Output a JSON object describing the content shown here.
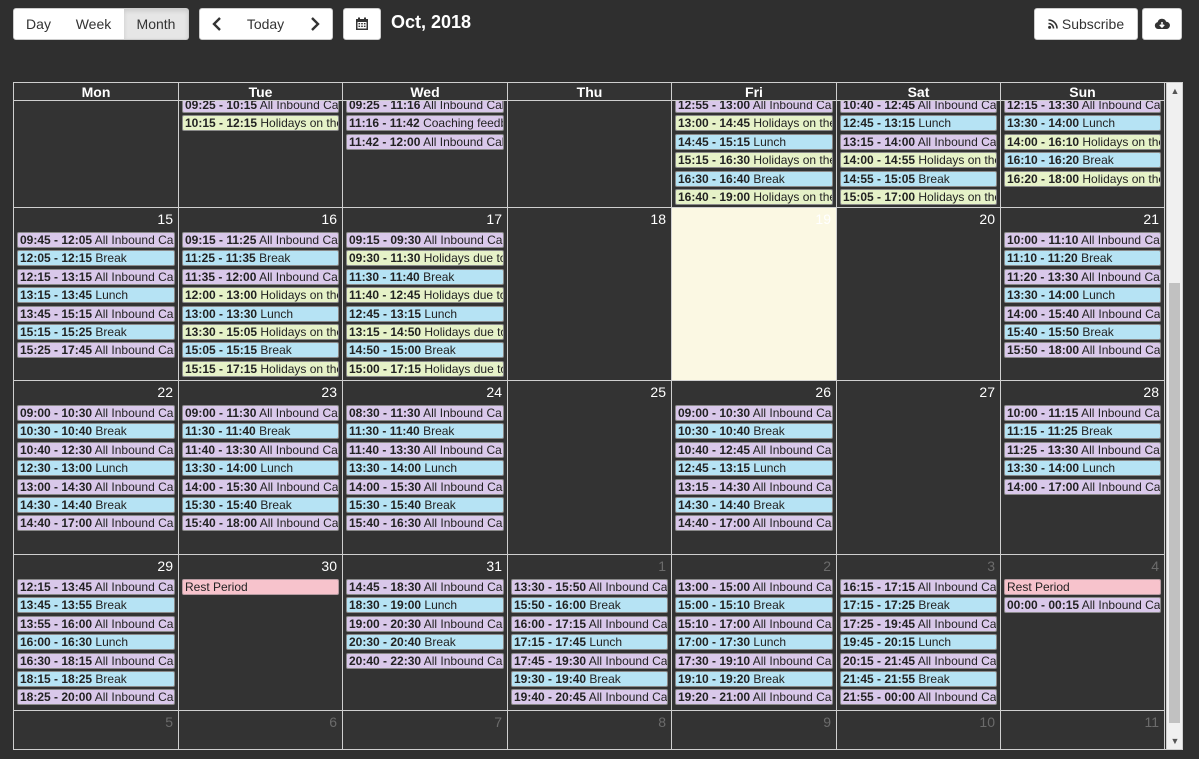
{
  "toolbar": {
    "day_label": "Day",
    "week_label": "Week",
    "month_label": "Month",
    "today_label": "Today",
    "title": "Oct, 2018",
    "subscribe_label": "Subscribe"
  },
  "weekdays": [
    "Mon",
    "Tue",
    "Wed",
    "Thu",
    "Fri",
    "Sat",
    "Sun"
  ],
  "weeks": [
    [
      {
        "day": "",
        "other": false,
        "events": []
      },
      {
        "day": "",
        "other": false,
        "events": [
          {
            "time": "09:25 - 10:15",
            "label": "All Inbound Ca",
            "kind": "inbound"
          },
          {
            "time": "10:15 - 12:15",
            "label": "Holidays on the",
            "kind": "holiday"
          }
        ]
      },
      {
        "day": "",
        "other": false,
        "events": [
          {
            "time": "09:25 - 11:16",
            "label": "All Inbound Cal",
            "kind": "inbound"
          },
          {
            "time": "11:16 - 11:42",
            "label": "Coaching feedb",
            "kind": "coaching"
          },
          {
            "time": "11:42 - 12:00",
            "label": "All Inbound Cal",
            "kind": "inbound"
          }
        ]
      },
      {
        "day": "",
        "other": false,
        "events": []
      },
      {
        "day": "",
        "other": false,
        "events": [
          {
            "time": "12:55 - 13:00",
            "label": "All Inbound Ca",
            "kind": "inbound"
          },
          {
            "time": "13:00 - 14:45",
            "label": "Holidays on the",
            "kind": "holiday"
          },
          {
            "time": "14:45 - 15:15",
            "label": "Lunch",
            "kind": "lunch"
          },
          {
            "time": "15:15 - 16:30",
            "label": "Holidays on the",
            "kind": "holiday"
          },
          {
            "time": "16:30 - 16:40",
            "label": "Break",
            "kind": "break"
          },
          {
            "time": "16:40 - 19:00",
            "label": "Holidays on the",
            "kind": "holiday"
          }
        ]
      },
      {
        "day": "",
        "other": false,
        "events": [
          {
            "time": "10:40 - 12:45",
            "label": "All Inbound Ca",
            "kind": "inbound"
          },
          {
            "time": "12:45 - 13:15",
            "label": "Lunch",
            "kind": "lunch"
          },
          {
            "time": "13:15 - 14:00",
            "label": "All Inbound Ca",
            "kind": "inbound"
          },
          {
            "time": "14:00 - 14:55",
            "label": "Holidays on the",
            "kind": "holiday"
          },
          {
            "time": "14:55 - 15:05",
            "label": "Break",
            "kind": "break"
          },
          {
            "time": "15:05 - 17:00",
            "label": "Holidays on the",
            "kind": "holiday"
          }
        ]
      },
      {
        "day": "",
        "other": false,
        "events": [
          {
            "time": "12:15 - 13:30",
            "label": "All Inbound Ca",
            "kind": "inbound"
          },
          {
            "time": "13:30 - 14:00",
            "label": "Lunch",
            "kind": "lunch"
          },
          {
            "time": "14:00 - 16:10",
            "label": "Holidays on the",
            "kind": "holiday"
          },
          {
            "time": "16:10 - 16:20",
            "label": "Break",
            "kind": "break"
          },
          {
            "time": "16:20 - 18:00",
            "label": "Holidays on the",
            "kind": "holiday"
          }
        ]
      }
    ],
    [
      {
        "day": "15",
        "other": false,
        "events": [
          {
            "time": "09:45 - 12:05",
            "label": "All Inbound Ca",
            "kind": "inbound"
          },
          {
            "time": "12:05 - 12:15",
            "label": "Break",
            "kind": "break"
          },
          {
            "time": "12:15 - 13:15",
            "label": "All Inbound Ca",
            "kind": "inbound"
          },
          {
            "time": "13:15 - 13:45",
            "label": "Lunch",
            "kind": "lunch"
          },
          {
            "time": "13:45 - 15:15",
            "label": "All Inbound Ca",
            "kind": "inbound"
          },
          {
            "time": "15:15 - 15:25",
            "label": "Break",
            "kind": "break"
          },
          {
            "time": "15:25 - 17:45",
            "label": "All Inbound Ca",
            "kind": "inbound"
          }
        ]
      },
      {
        "day": "16",
        "other": false,
        "events": [
          {
            "time": "09:15 - 11:25",
            "label": "All Inbound Ca",
            "kind": "inbound"
          },
          {
            "time": "11:25 - 11:35",
            "label": "Break",
            "kind": "break"
          },
          {
            "time": "11:35 - 12:00",
            "label": "All Inbound Ca",
            "kind": "inbound"
          },
          {
            "time": "12:00 - 13:00",
            "label": "Holidays on the",
            "kind": "holiday"
          },
          {
            "time": "13:00 - 13:30",
            "label": "Lunch",
            "kind": "lunch"
          },
          {
            "time": "13:30 - 15:05",
            "label": "Holidays on the",
            "kind": "holiday"
          },
          {
            "time": "15:05 - 15:15",
            "label": "Break",
            "kind": "break"
          },
          {
            "time": "15:15 - 17:15",
            "label": "Holidays on the",
            "kind": "holiday"
          }
        ]
      },
      {
        "day": "17",
        "other": false,
        "events": [
          {
            "time": "09:15 - 09:30",
            "label": "All Inbound Ca",
            "kind": "inbound"
          },
          {
            "time": "09:30 - 11:30",
            "label": "Holidays due to",
            "kind": "holiday"
          },
          {
            "time": "11:30 - 11:40",
            "label": "Break",
            "kind": "break"
          },
          {
            "time": "11:40 - 12:45",
            "label": "Holidays due to",
            "kind": "holiday"
          },
          {
            "time": "12:45 - 13:15",
            "label": "Lunch",
            "kind": "lunch"
          },
          {
            "time": "13:15 - 14:50",
            "label": "Holidays due to",
            "kind": "holiday"
          },
          {
            "time": "14:50 - 15:00",
            "label": "Break",
            "kind": "break"
          },
          {
            "time": "15:00 - 17:15",
            "label": "Holidays due to",
            "kind": "holiday"
          }
        ]
      },
      {
        "day": "18",
        "other": false,
        "events": []
      },
      {
        "day": "19",
        "other": false,
        "today": true,
        "events": []
      },
      {
        "day": "20",
        "other": false,
        "events": []
      },
      {
        "day": "21",
        "other": false,
        "events": [
          {
            "time": "10:00 - 11:10",
            "label": "All Inbound Cal",
            "kind": "inbound"
          },
          {
            "time": "11:10 - 11:20",
            "label": "Break",
            "kind": "break"
          },
          {
            "time": "11:20 - 13:30",
            "label": "All Inbound Cal",
            "kind": "inbound"
          },
          {
            "time": "13:30 - 14:00",
            "label": "Lunch",
            "kind": "lunch"
          },
          {
            "time": "14:00 - 15:40",
            "label": "All Inbound Ca",
            "kind": "inbound"
          },
          {
            "time": "15:40 - 15:50",
            "label": "Break",
            "kind": "break"
          },
          {
            "time": "15:50 - 18:00",
            "label": "All Inbound Ca",
            "kind": "inbound"
          }
        ]
      }
    ],
    [
      {
        "day": "22",
        "other": false,
        "events": [
          {
            "time": "09:00 - 10:30",
            "label": "All Inbound Ca",
            "kind": "inbound"
          },
          {
            "time": "10:30 - 10:40",
            "label": "Break",
            "kind": "break"
          },
          {
            "time": "10:40 - 12:30",
            "label": "All Inbound Ca",
            "kind": "inbound"
          },
          {
            "time": "12:30 - 13:00",
            "label": "Lunch",
            "kind": "lunch"
          },
          {
            "time": "13:00 - 14:30",
            "label": "All Inbound Ca",
            "kind": "inbound"
          },
          {
            "time": "14:30 - 14:40",
            "label": "Break",
            "kind": "break"
          },
          {
            "time": "14:40 - 17:00",
            "label": "All Inbound Ca",
            "kind": "inbound"
          }
        ]
      },
      {
        "day": "23",
        "other": false,
        "events": [
          {
            "time": "09:00 - 11:30",
            "label": "All Inbound Ca",
            "kind": "inbound"
          },
          {
            "time": "11:30 - 11:40",
            "label": "Break",
            "kind": "break"
          },
          {
            "time": "11:40 - 13:30",
            "label": "All Inbound Ca",
            "kind": "inbound"
          },
          {
            "time": "13:30 - 14:00",
            "label": "Lunch",
            "kind": "lunch"
          },
          {
            "time": "14:00 - 15:30",
            "label": "All Inbound Ca",
            "kind": "inbound"
          },
          {
            "time": "15:30 - 15:40",
            "label": "Break",
            "kind": "break"
          },
          {
            "time": "15:40 - 18:00",
            "label": "All Inbound Ca",
            "kind": "inbound"
          }
        ]
      },
      {
        "day": "24",
        "other": false,
        "events": [
          {
            "time": "08:30 - 11:30",
            "label": "All Inbound Ca",
            "kind": "inbound"
          },
          {
            "time": "11:30 - 11:40",
            "label": "Break",
            "kind": "break"
          },
          {
            "time": "11:40 - 13:30",
            "label": "All Inbound Ca",
            "kind": "inbound"
          },
          {
            "time": "13:30 - 14:00",
            "label": "Lunch",
            "kind": "lunch"
          },
          {
            "time": "14:00 - 15:30",
            "label": "All Inbound Ca",
            "kind": "inbound"
          },
          {
            "time": "15:30 - 15:40",
            "label": "Break",
            "kind": "break"
          },
          {
            "time": "15:40 - 16:30",
            "label": "All Inbound Ca",
            "kind": "inbound"
          }
        ]
      },
      {
        "day": "25",
        "other": false,
        "events": []
      },
      {
        "day": "26",
        "other": false,
        "events": [
          {
            "time": "09:00 - 10:30",
            "label": "All Inbound Ca",
            "kind": "inbound"
          },
          {
            "time": "10:30 - 10:40",
            "label": "Break",
            "kind": "break"
          },
          {
            "time": "10:40 - 12:45",
            "label": "All Inbound Ca",
            "kind": "inbound"
          },
          {
            "time": "12:45 - 13:15",
            "label": "Lunch",
            "kind": "lunch"
          },
          {
            "time": "13:15 - 14:30",
            "label": "All Inbound Ca",
            "kind": "inbound"
          },
          {
            "time": "14:30 - 14:40",
            "label": "Break",
            "kind": "break"
          },
          {
            "time": "14:40 - 17:00",
            "label": "All Inbound Ca",
            "kind": "inbound"
          }
        ]
      },
      {
        "day": "27",
        "other": false,
        "events": []
      },
      {
        "day": "28",
        "other": false,
        "events": [
          {
            "time": "10:00 - 11:15",
            "label": "All Inbound Cal",
            "kind": "inbound"
          },
          {
            "time": "11:15 - 11:25",
            "label": "Break",
            "kind": "break"
          },
          {
            "time": "11:25 - 13:30",
            "label": "All Inbound Ca",
            "kind": "inbound"
          },
          {
            "time": "13:30 - 14:00",
            "label": "Lunch",
            "kind": "lunch"
          },
          {
            "time": "14:00 - 17:00",
            "label": "All Inbound Ca",
            "kind": "inbound"
          }
        ]
      }
    ],
    [
      {
        "day": "29",
        "other": false,
        "events": [
          {
            "time": "12:15 - 13:45",
            "label": "All Inbound Ca",
            "kind": "inbound"
          },
          {
            "time": "13:45 - 13:55",
            "label": "Break",
            "kind": "break"
          },
          {
            "time": "13:55 - 16:00",
            "label": "All Inbound Ca",
            "kind": "inbound"
          },
          {
            "time": "16:00 - 16:30",
            "label": "Lunch",
            "kind": "lunch"
          },
          {
            "time": "16:30 - 18:15",
            "label": "All Inbound Ca",
            "kind": "inbound"
          },
          {
            "time": "18:15 - 18:25",
            "label": "Break",
            "kind": "break"
          },
          {
            "time": "18:25 - 20:00",
            "label": "All Inbound Ca",
            "kind": "inbound"
          }
        ]
      },
      {
        "day": "30",
        "other": false,
        "events": [
          {
            "time": "",
            "label": "Rest Period",
            "kind": "rest"
          }
        ]
      },
      {
        "day": "31",
        "other": false,
        "events": [
          {
            "time": "14:45 - 18:30",
            "label": "All Inbound Ca",
            "kind": "inbound"
          },
          {
            "time": "18:30 - 19:00",
            "label": "Lunch",
            "kind": "lunch"
          },
          {
            "time": "19:00 - 20:30",
            "label": "All Inbound Ca",
            "kind": "inbound"
          },
          {
            "time": "20:30 - 20:40",
            "label": "Break",
            "kind": "break"
          },
          {
            "time": "20:40 - 22:30",
            "label": "All Inbound Ca",
            "kind": "inbound"
          }
        ]
      },
      {
        "day": "1",
        "other": true,
        "events": [
          {
            "time": "13:30 - 15:50",
            "label": "All Inbound Ca",
            "kind": "inbound"
          },
          {
            "time": "15:50 - 16:00",
            "label": "Break",
            "kind": "break"
          },
          {
            "time": "16:00 - 17:15",
            "label": "All Inbound Ca",
            "kind": "inbound"
          },
          {
            "time": "17:15 - 17:45",
            "label": "Lunch",
            "kind": "lunch"
          },
          {
            "time": "17:45 - 19:30",
            "label": "All Inbound Ca",
            "kind": "inbound"
          },
          {
            "time": "19:30 - 19:40",
            "label": "Break",
            "kind": "break"
          },
          {
            "time": "19:40 - 20:45",
            "label": "All Inbound Ca",
            "kind": "inbound"
          }
        ]
      },
      {
        "day": "2",
        "other": true,
        "events": [
          {
            "time": "13:00 - 15:00",
            "label": "All Inbound Ca",
            "kind": "inbound"
          },
          {
            "time": "15:00 - 15:10",
            "label": "Break",
            "kind": "break"
          },
          {
            "time": "15:10 - 17:00",
            "label": "All Inbound Ca",
            "kind": "inbound"
          },
          {
            "time": "17:00 - 17:30",
            "label": "Lunch",
            "kind": "lunch"
          },
          {
            "time": "17:30 - 19:10",
            "label": "All Inbound Ca",
            "kind": "inbound"
          },
          {
            "time": "19:10 - 19:20",
            "label": "Break",
            "kind": "break"
          },
          {
            "time": "19:20 - 21:00",
            "label": "All Inbound Ca",
            "kind": "inbound"
          }
        ]
      },
      {
        "day": "3",
        "other": true,
        "events": [
          {
            "time": "16:15 - 17:15",
            "label": "All Inbound Ca",
            "kind": "inbound"
          },
          {
            "time": "17:15 - 17:25",
            "label": "Break",
            "kind": "break"
          },
          {
            "time": "17:25 - 19:45",
            "label": "All Inbound Ca",
            "kind": "inbound"
          },
          {
            "time": "19:45 - 20:15",
            "label": "Lunch",
            "kind": "lunch"
          },
          {
            "time": "20:15 - 21:45",
            "label": "All Inbound Ca",
            "kind": "inbound"
          },
          {
            "time": "21:45 - 21:55",
            "label": "Break",
            "kind": "break"
          },
          {
            "time": "21:55 - 00:00",
            "label": "All Inbound Ca",
            "kind": "inbound"
          }
        ]
      },
      {
        "day": "4",
        "other": true,
        "events": [
          {
            "time": "",
            "label": "Rest Period",
            "kind": "rest"
          },
          {
            "time": "00:00 - 00:15",
            "label": "All Inbound Ca",
            "kind": "inbound"
          }
        ]
      }
    ],
    [
      {
        "day": "5",
        "other": true,
        "events": []
      },
      {
        "day": "6",
        "other": true,
        "events": []
      },
      {
        "day": "7",
        "other": true,
        "events": []
      },
      {
        "day": "8",
        "other": true,
        "events": []
      },
      {
        "day": "9",
        "other": true,
        "events": []
      },
      {
        "day": "10",
        "other": true,
        "events": []
      },
      {
        "day": "11",
        "other": true,
        "events": []
      }
    ]
  ],
  "colors": {
    "background": "#2f2f2f",
    "inbound": "#d9c8ea",
    "break": "#b6e3f4",
    "holiday": "#e6f2c8",
    "rest": "#f7c3cc",
    "today": "#fbf8e3"
  },
  "icons": {
    "calendar": "calendar-icon",
    "prev": "chevron-left-icon",
    "next": "chevron-right-icon",
    "rss": "rss-icon",
    "download": "cloud-download-icon"
  }
}
